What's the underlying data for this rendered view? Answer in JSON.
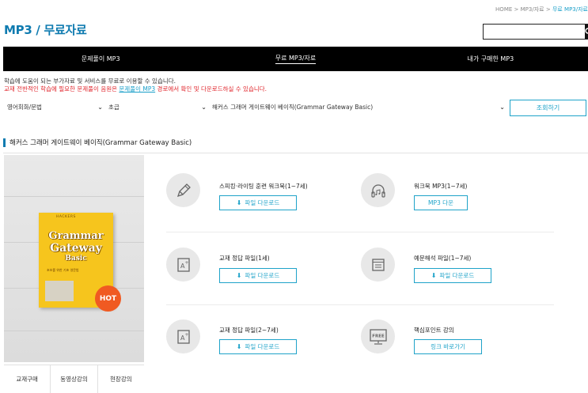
{
  "breadcrumb": {
    "home": "HOME",
    "sep1": ">",
    "mid": "MP3/자료",
    "sep2": ">",
    "current": "무료 MP3/자료"
  },
  "page_title": "MP3 / 무료자료",
  "search": {
    "value": "",
    "placeholder": ""
  },
  "tabs": [
    {
      "label": "문제풀이 MP3",
      "active": false
    },
    {
      "label": "무료 MP3/자료",
      "active": true
    },
    {
      "label": "내가 구매한 MP3",
      "active": false
    }
  ],
  "description": {
    "line1": "학습에 도움이 되는 부가자료 및 서비스를 무료로 이용할 수 있습니다.",
    "line2_a": "교재 전반적인 학습에 필요한 문제풀이 음원은 ",
    "line2_link": "문제풀이 MP3",
    "line2_b": " 경로에서 확인 및 다운로드하실 수 있습니다."
  },
  "filters": {
    "category": "영어회화/문법",
    "level": "초급",
    "book": "해커스 그래머 게이트웨이 베이직(Grammar Gateway Basic)",
    "search_button": "조회하기"
  },
  "section_title": "해커스 그래머 게이트웨이 베이직(Grammar Gateway Basic)",
  "book_cover": {
    "brand": "HACKERS",
    "title1": "Grammar",
    "title2": "Gateway",
    "title3": "Basic",
    "subtitle": "초보를 위한 기초 영문법",
    "badge": "HOT"
  },
  "book_links": [
    "교재구매",
    "동영상강의",
    "현장강의"
  ],
  "resources": [
    {
      "title": "스피킹·라이팅 훈련 워크북(1~7세)",
      "button": "파일 다운로드",
      "icon": "pencil-icon",
      "has_download_icon": true
    },
    {
      "title": "워크북 MP3(1~7세)",
      "button": "MP3 다운",
      "icon": "headphones-icon",
      "has_download_icon": false
    },
    {
      "title": "교재 정답 파일(1세)",
      "button": "파일 다운로드",
      "icon": "answer-sheet-icon",
      "has_download_icon": true
    },
    {
      "title": "예문해석 파일(1~7세)",
      "button": "파일 다운로드",
      "icon": "document-icon",
      "has_download_icon": true
    },
    {
      "title": "교재 정답 파일(2~7세)",
      "button": "파일 다운로드",
      "icon": "answer-sheet-icon",
      "has_download_icon": true
    },
    {
      "title": "핵심포인트 강의",
      "button": "링크 바로가기",
      "icon": "free-lecture-icon",
      "icon_text": "FREE",
      "has_download_icon": false
    }
  ],
  "colors": {
    "accent": "#1fa3c9",
    "title_blue": "#0f7bb0",
    "warning_red": "#e0262c",
    "hot_orange": "#f05a22",
    "book_yellow": "#f6c51d"
  }
}
